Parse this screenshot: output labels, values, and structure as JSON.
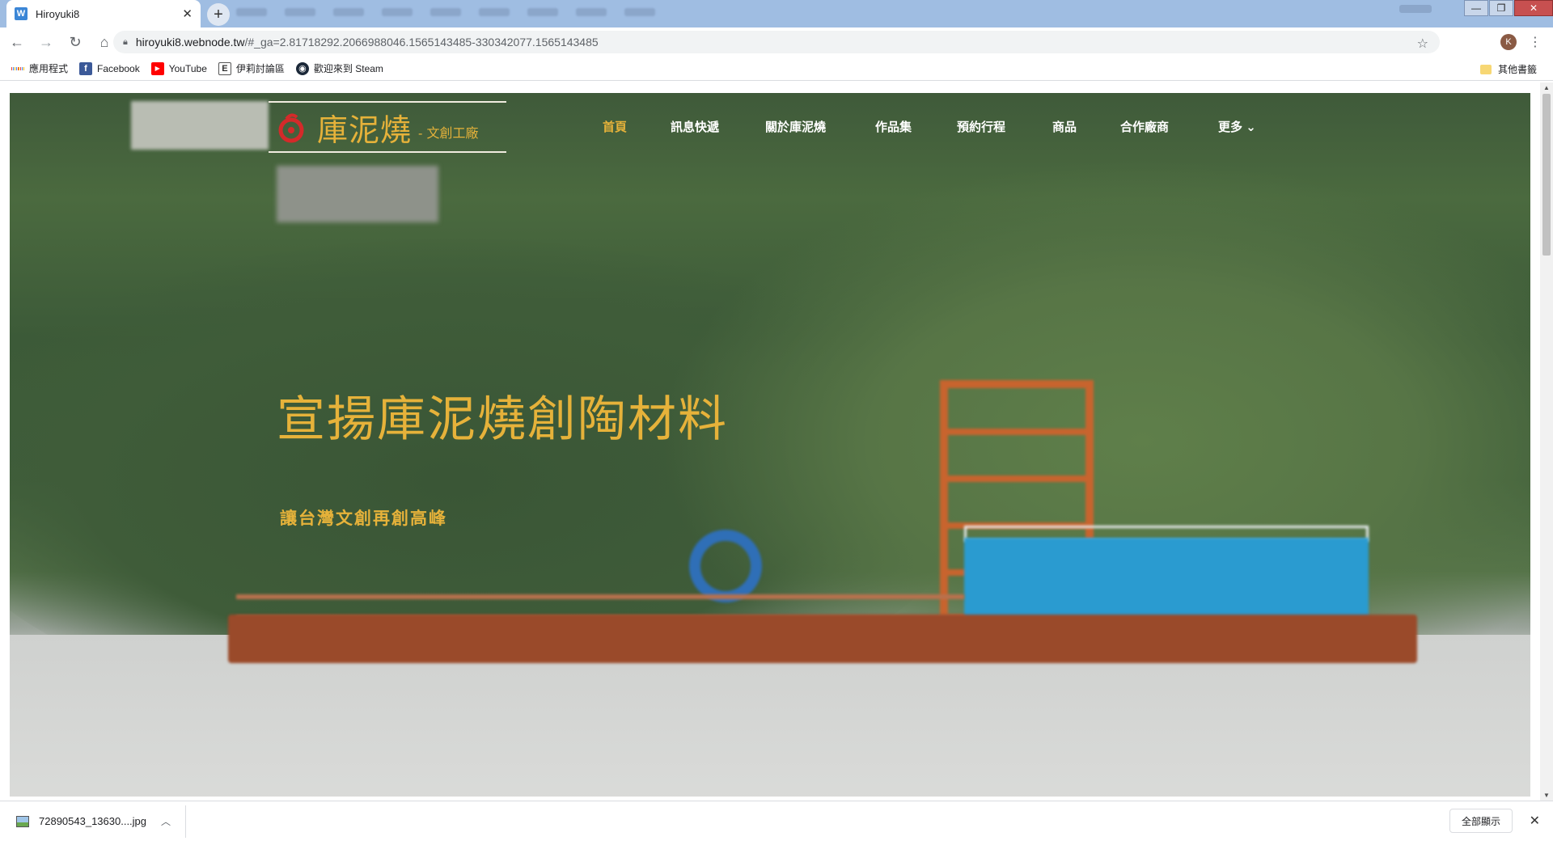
{
  "browser": {
    "tab_title": "Hiroyuki8",
    "tab_favicon": "W",
    "tab_close": "✕",
    "new_tab": "+",
    "url_main": "hiroyuki8.webnode.tw",
    "url_rest": "/#_ga=2.81718292.2066988046.1565143485-330342077.1565143485",
    "profile_initial": "K",
    "window_controls": {
      "minimize": "—",
      "maximize": "❐",
      "close": "✕"
    }
  },
  "bookmarks": {
    "items": [
      {
        "label": "應用程式",
        "icon": "apps-grid-icon"
      },
      {
        "label": "Facebook",
        "icon": "facebook-icon"
      },
      {
        "label": "YouTube",
        "icon": "youtube-icon"
      },
      {
        "label": "伊莉討論區",
        "icon": "eyny-icon"
      },
      {
        "label": "歡迎來到 Steam",
        "icon": "steam-icon"
      }
    ],
    "other": "其他書籤"
  },
  "site": {
    "logo_main": "庫泥燒",
    "logo_sub": "- 文創工廠",
    "nav": [
      {
        "label": "首頁",
        "active": true
      },
      {
        "label": "訊息快遞",
        "active": false
      },
      {
        "label": "關於庫泥燒",
        "active": false
      },
      {
        "label": "作品集",
        "active": false
      },
      {
        "label": "預約行程",
        "active": false
      },
      {
        "label": "商品",
        "active": false
      },
      {
        "label": "合作廠商",
        "active": false
      },
      {
        "label": "更多",
        "active": false
      }
    ],
    "more_chevron": "⌄",
    "hero_title": "宣揚庫泥燒創陶材料",
    "hero_subtitle": "讓台灣文創再創高峰"
  },
  "downloads": {
    "file_name": "72890543_13630....jpg",
    "show_all": "全部顯示",
    "close": "✕"
  },
  "colors": {
    "accent": "#e6b23a",
    "tabstrip": "#9fbde2"
  }
}
